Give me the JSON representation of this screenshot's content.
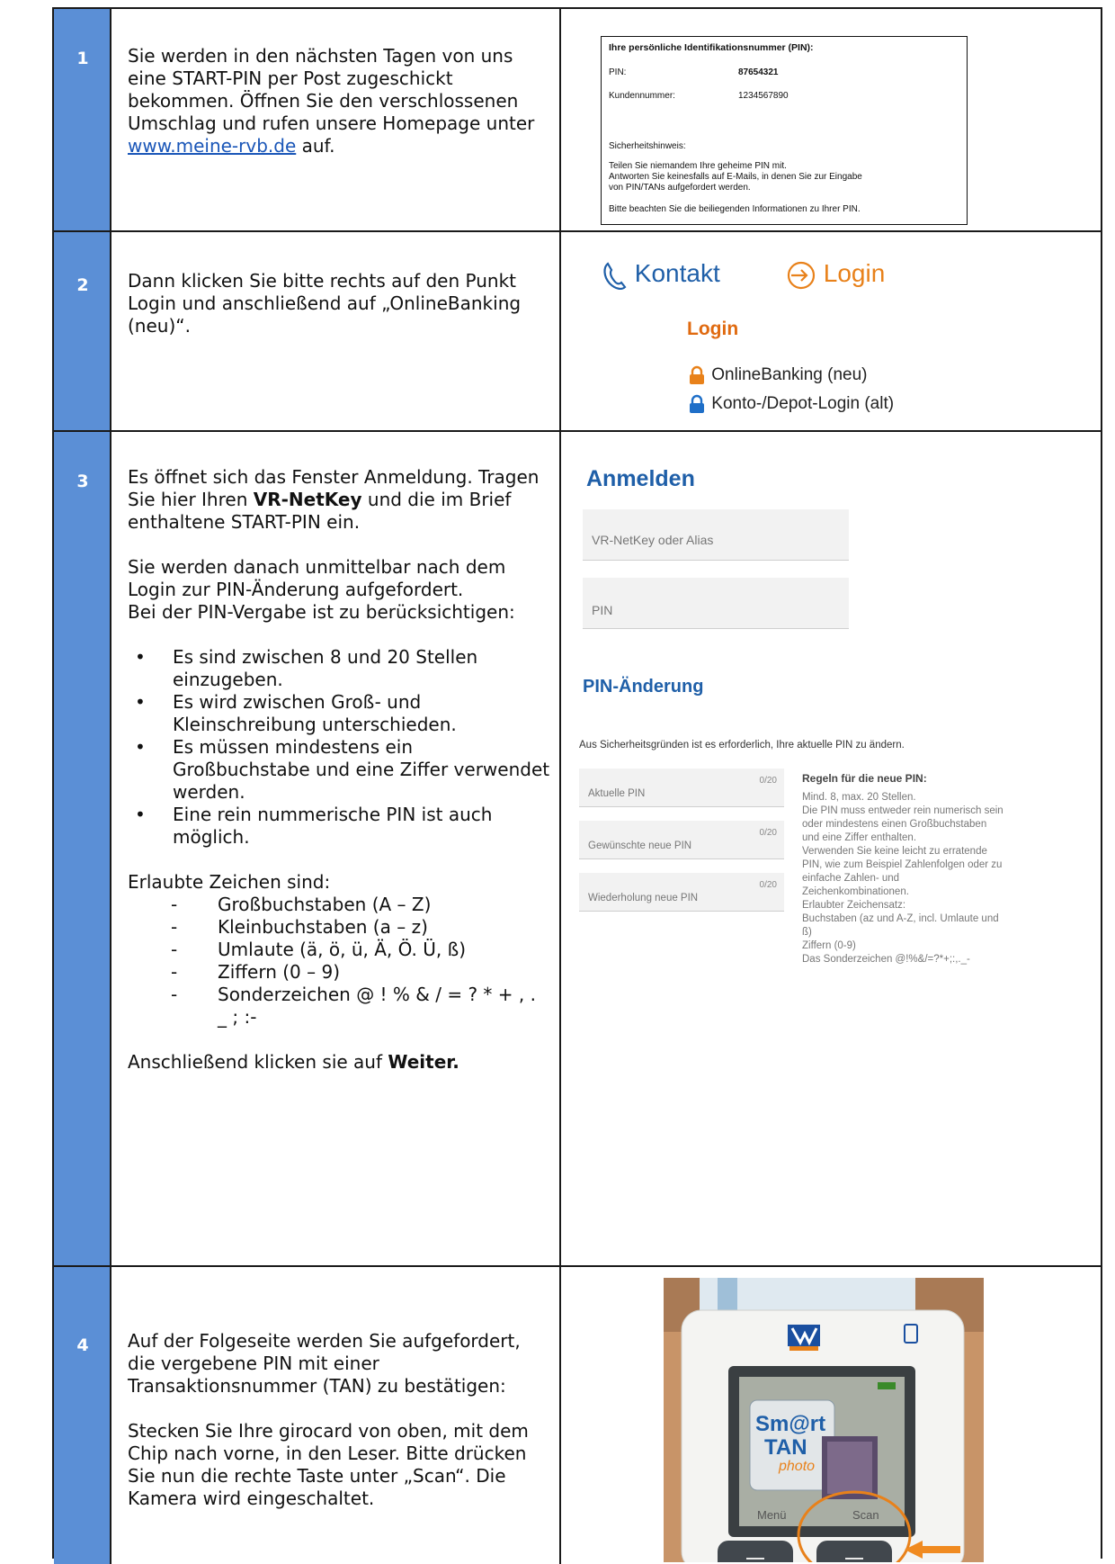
{
  "rows": [
    {
      "number": "1",
      "text_before_link": "Sie werden in den nächsten Tagen von uns eine START-PIN per Post zugeschickt bekommen. Öffnen Sie den verschlossenen Umschlag und rufen unsere Homepage unter ",
      "link": "www.meine-rvb.de",
      "text_after_link": " auf.",
      "letter": {
        "title": "Ihre persönliche Identifikationsnummer (PIN):",
        "pin_label": "PIN:",
        "pin_value": "87654321",
        "customer_label": "Kundennummer:",
        "customer_value": "1234567890",
        "security_title": "Sicherheitshinweis:",
        "security_line1": "Teilen Sie niemandem Ihre geheime PIN mit.",
        "security_line2": "Antworten Sie keinesfalls auf E-Mails, in denen Sie zur Eingabe",
        "security_line3": "von PIN/TANs aufgefordert  werden.",
        "footer": "Bitte beachten Sie die beiliegenden Informationen zu Ihrer PIN."
      }
    },
    {
      "number": "2",
      "text": "Dann klicken Sie bitte rechts auf den Punkt Login und anschließend auf „OnlineBanking (neu)“.",
      "nav": {
        "kontakt": "Kontakt",
        "login": "Login"
      },
      "menu_title": "Login",
      "menu_items": [
        "OnlineBanking (neu)",
        "Konto-/Depot-Login (alt)"
      ]
    },
    {
      "number": "3",
      "p1_a": "Es öffnet sich das Fenster Anmeldung. Tragen Sie hier Ihren ",
      "p1_bold": "VR-NetKey",
      "p1_b": " und die im Brief enthaltene START-PIN ein.",
      "p2": "Sie werden danach unmittelbar nach dem Login zur PIN-Änderung aufgefordert.",
      "p3": "Bei der PIN-Vergabe ist zu berücksichtigen:",
      "bullets": [
        "Es sind zwischen 8 und 20 Stellen einzugeben.",
        "Es wird zwischen Groß- und Kleinschreibung unterschieden.",
        "Es müssen mindestens ein Großbuchstabe und eine Ziffer verwendet werden.",
        "Eine rein nummerische PIN ist auch möglich."
      ],
      "allowed_title": "Erlaubte Zeichen sind:",
      "allowed": [
        "Großbuchstaben (A – Z)",
        "Kleinbuchstaben (a – z)",
        "Umlaute (ä, ö, ü, Ä, Ö. Ü, ß)",
        "Ziffern (0 – 9)",
        "Sonderzeichen @ ! % & / = ? * + , . _ ; :-"
      ],
      "final_a": "Anschließend klicken sie auf ",
      "final_bold": "Weiter.",
      "login_form": {
        "title": "Anmelden",
        "netkey_placeholder": "VR-NetKey oder Alias",
        "pin_placeholder": "PIN"
      },
      "change_form": {
        "title": "PIN-Änderung",
        "intro": "Aus Sicherheitsgründen ist es erforderlich, Ihre aktuelle PIN zu ändern.",
        "fields": [
          {
            "label": "Aktuelle PIN",
            "counter": "0/20"
          },
          {
            "label": "Gewünschte neue PIN",
            "counter": "0/20"
          },
          {
            "label": "Wiederholung neue PIN",
            "counter": "0/20"
          }
        ],
        "rules_title": "Regeln für die neue PIN:",
        "rules_lines": [
          "Mind. 8, max. 20 Stellen.",
          "Die PIN muss entweder rein numerisch sein",
          "oder mindestens einen Großbuchstaben",
          "und eine Ziffer enthalten.",
          "Verwenden Sie keine leicht zu erratende",
          "PIN, wie zum Beispiel Zahlenfolgen oder zu",
          "einfache Zahlen- und",
          "Zeichenkombinationen.",
          "Erlaubter Zeichensatz:",
          "Buchstaben (az und A-Z, incl. Umlaute und",
          "ß)",
          "Ziffern (0-9)",
          "Das Sonderzeichen @!%&/=?*+;:,._-"
        ]
      }
    },
    {
      "number": "4",
      "p1": "Auf der Folgeseite werden Sie aufgefordert, die vergebene PIN mit einer Transaktionsnummer (TAN) zu bestätigen:",
      "p2": "Stecken Sie Ihre girocard von oben, mit dem Chip nach vorne, in den Leser. Bitte drücken Sie nun die rechte Taste unter „Scan“. Die Kamera wird eingeschaltet.",
      "device": {
        "logo_line1": "Sm@rt",
        "logo_line2": "TAN",
        "logo_line3": "photo",
        "softkey_left": "Menü",
        "softkey_right": "Scan"
      }
    }
  ]
}
